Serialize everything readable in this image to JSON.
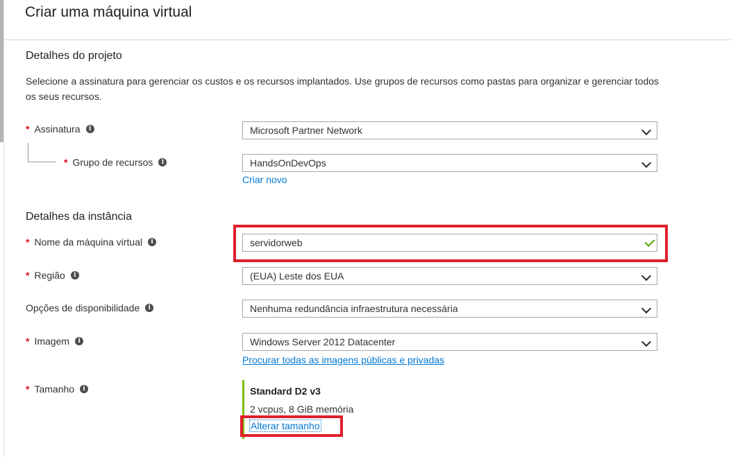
{
  "page": {
    "title": "Criar uma máquina virtual"
  },
  "project": {
    "heading": "Detalhes do projeto",
    "description": "Selecione a assinatura para gerenciar os custos e os recursos implantados. Use grupos de recursos como pastas para organizar e gerenciar todos os seus recursos.",
    "subscription": {
      "label": "Assinatura",
      "value": "Microsoft Partner Network",
      "info_icon": "info-icon"
    },
    "resource_group": {
      "label": "Grupo de recursos",
      "value": "HandsOnDevOps",
      "create_new": "Criar novo",
      "info_icon": "info-icon"
    }
  },
  "instance": {
    "heading": "Detalhes da instância",
    "vm_name": {
      "label": "Nome da máquina virtual",
      "value": "servidorweb",
      "valid_icon": "checkmark-icon"
    },
    "region": {
      "label": "Região",
      "value": "(EUA) Leste dos EUA"
    },
    "availability": {
      "label": "Opções de disponibilidade",
      "value": "Nenhuma redundância infraestrutura necessária"
    },
    "image": {
      "label": "Imagem",
      "value": "Windows Server 2012 Datacenter",
      "browse_link": "Procurar todas as imagens públicas e privadas"
    },
    "size": {
      "label": "Tamanho",
      "name": "Standard D2 v3",
      "specs": "2 vcpus, 8 GiB memória",
      "change_link": "Alterar tamanho"
    }
  },
  "required_marker": "*",
  "info_glyph": "i",
  "colors": {
    "required": "#e00b1c",
    "link": "#0078d4",
    "highlight": "#e01e2b",
    "valid": "#57a300",
    "size_accent": "#7fba00"
  }
}
